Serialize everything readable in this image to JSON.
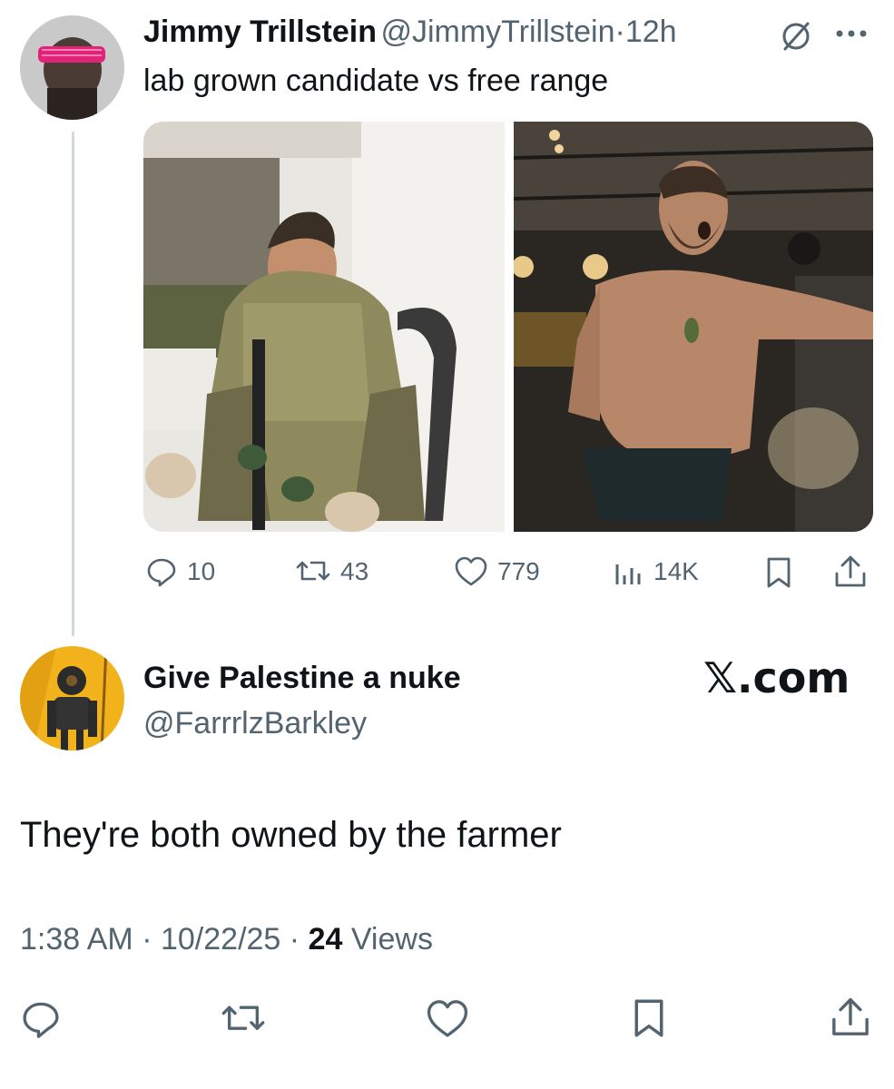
{
  "parent_tweet": {
    "author_name": "Jimmy Trillstein",
    "author_handle": "@JimmyTrillstein",
    "separator": "·",
    "time": "12h",
    "text": "lab grown candidate vs free range",
    "avatar_icon": "avatar-pink-sunglasses",
    "stats": {
      "replies": "10",
      "reposts": "43",
      "likes": "779",
      "views": "14K"
    },
    "media": [
      {
        "name": "photo-soldier-uniform"
      },
      {
        "name": "photo-shirtless-man-party"
      }
    ]
  },
  "reply": {
    "author_name": "Give Palestine a nuke",
    "author_handle": "@FarrrlzBarkley",
    "avatar_icon": "avatar-robot-yellow",
    "brand": "𝕏.com",
    "text": "They're both owned by the farmer",
    "time": "1:38 AM",
    "date": "10/22/25",
    "views_count": "24",
    "views_label": "Views",
    "separator": "·"
  },
  "colors": {
    "primary_text": "#0f1419",
    "secondary_text": "#536471",
    "thread_line": "#cfd9de",
    "avatar_pink": "#e0247a",
    "avatar_yellow": "#f2b21b"
  }
}
